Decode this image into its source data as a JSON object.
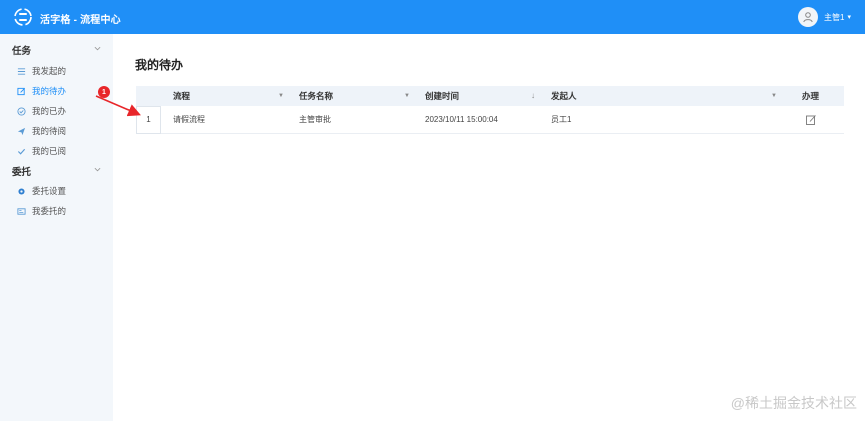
{
  "header": {
    "app_title": "活字格 - 流程中心",
    "user_name": "主管1"
  },
  "sidebar": {
    "groups": [
      {
        "label": "任务",
        "items": [
          {
            "label": "我发起的",
            "icon": "list-icon"
          },
          {
            "label": "我的待办",
            "icon": "edit-icon",
            "active": true,
            "badge": "1"
          },
          {
            "label": "我的已办",
            "icon": "check-circle-icon"
          },
          {
            "label": "我的待阅",
            "icon": "send-icon"
          },
          {
            "label": "我的已阅",
            "icon": "check-icon"
          }
        ]
      },
      {
        "label": "委托",
        "items": [
          {
            "label": "委托设置",
            "icon": "gear-icon"
          },
          {
            "label": "我委托的",
            "icon": "card-icon"
          }
        ]
      }
    ]
  },
  "main": {
    "page_title": "我的待办",
    "table": {
      "columns": [
        "流程",
        "任务名称",
        "创建时间",
        "发起人",
        "办理"
      ],
      "rows": [
        {
          "index": "1",
          "process": "请假流程",
          "task_name": "主管审批",
          "created_at": "2023/10/11 15:00:04",
          "initiator": "员工1"
        }
      ]
    }
  },
  "watermark": "@稀土掘金技术社区",
  "colors": {
    "brand": "#1f8ff7",
    "sidebar_bg": "#f3f7fb",
    "badge": "#e8262a"
  }
}
